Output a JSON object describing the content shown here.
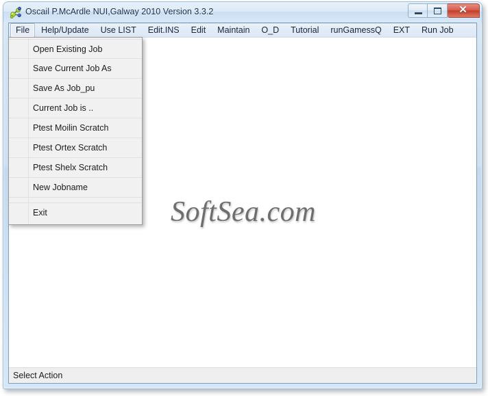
{
  "window": {
    "title": "Oscail P.McArdle NUI,Galway 2010 Version 3.3.2",
    "icon": "molecule-icon",
    "controls": {
      "minimize_label": "–",
      "maximize_label": "❐",
      "close_label": "✕"
    },
    "colors": {
      "frame": "#cfe0f2",
      "titlebar_text": "#16304d",
      "close_button": "#c23b2a",
      "client_background": "#ffffff",
      "menu_background": "#e2ecf6",
      "dropdown_background": "#f1f1f1",
      "statusbar_background": "#efefef",
      "watermark": "#6e6e6e"
    }
  },
  "menubar": {
    "items": [
      {
        "label": "File",
        "open": true
      },
      {
        "label": "Help/Update",
        "open": false
      },
      {
        "label": "Use LIST",
        "open": false
      },
      {
        "label": "Edit.INS",
        "open": false
      },
      {
        "label": "Edit",
        "open": false
      },
      {
        "label": "Maintain",
        "open": false
      },
      {
        "label": "O_D",
        "open": false
      },
      {
        "label": "Tutorial",
        "open": false
      },
      {
        "label": "runGamessQ",
        "open": false
      },
      {
        "label": "EXT",
        "open": false
      },
      {
        "label": "Run Job",
        "open": false
      }
    ]
  },
  "file_menu": {
    "items": [
      {
        "label": "Open Existing Job"
      },
      {
        "label": "Save Current Job As"
      },
      {
        "label": "Save As Job_pu"
      },
      {
        "label": "Current Job is .."
      },
      {
        "label": "Ptest Moilin Scratch"
      },
      {
        "label": "Ptest Ortex Scratch"
      },
      {
        "label": "Ptest Shelx Scratch"
      },
      {
        "label": "New Jobname"
      },
      {
        "label": "Exit"
      }
    ]
  },
  "client": {
    "watermark": "SoftSea.com"
  },
  "statusbar": {
    "text": "Select Action"
  }
}
